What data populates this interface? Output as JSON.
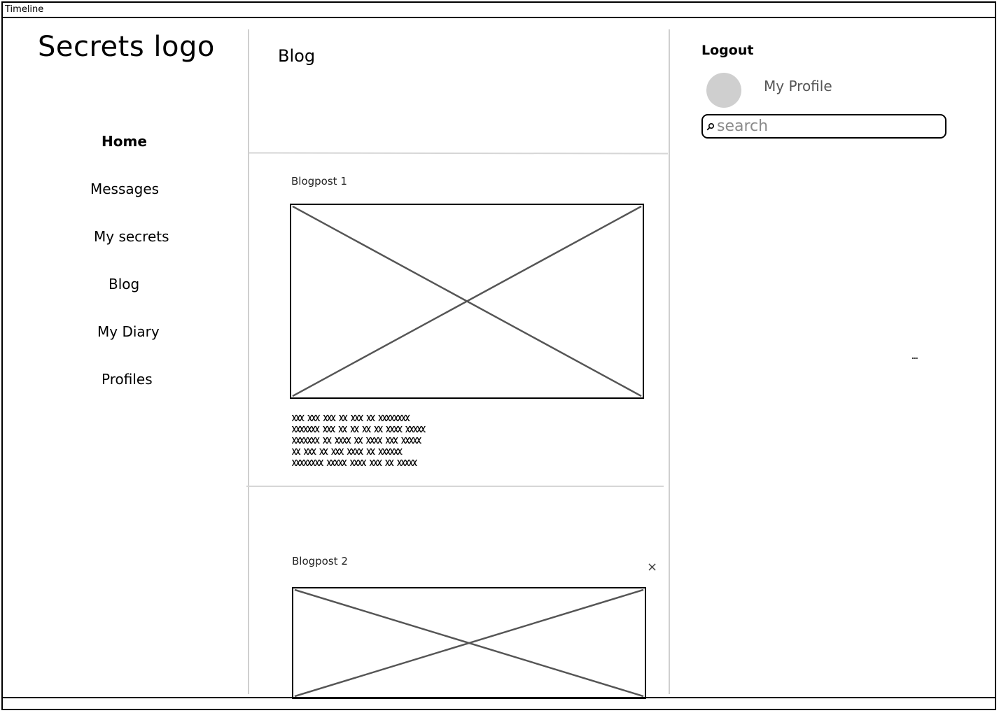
{
  "window": {
    "title": "Timeline"
  },
  "sidebar": {
    "logo": "Secrets logo",
    "items": [
      {
        "label": "Home",
        "active": true
      },
      {
        "label": "Messages",
        "active": false
      },
      {
        "label": "My secrets",
        "active": false
      },
      {
        "label": "Blog",
        "active": false
      },
      {
        "label": "My Diary",
        "active": false
      },
      {
        "label": "Profiles",
        "active": false
      }
    ]
  },
  "main": {
    "title": "Blog",
    "posts": [
      {
        "title": "Blogpost 1",
        "image": "image-placeholder-icon",
        "text_lines": [
          "ꭓꭓꭓ ꭓꭓꭓ ꭓꭓꭓ ꭓꭓ ꭓꭓꭓ ꭓꭓ ꭓꭓꭓꭓꭓꭓꭓꭓ",
          "ꭓꭓꭓꭓꭓꭓꭓ ꭓꭓꭓ ꭓꭓ ꭓꭓ ꭓꭓ ꭓꭓ ꭓꭓꭓꭓ ꭓꭓꭓꭓꭓ",
          "ꭓꭓꭓꭓꭓꭓꭓ ꭓꭓ ꭓꭓꭓꭓ ꭓꭓ ꭓꭓꭓꭓ ꭓꭓꭓ ꭓꭓꭓꭓꭓ",
          "ꭓꭓ ꭓꭓꭓ ꭓꭓ ꭓꭓꭓ ꭓꭓꭓꭓ ꭓꭓ ꭓꭓꭓꭓꭓꭓ",
          "ꭓꭓꭓꭓꭓꭓꭓꭓ ꭓꭓꭓꭓꭓ ꭓꭓꭓꭓ ꭓꭓꭓ ꭓꭓ ꭓꭓꭓꭓꭓ"
        ]
      },
      {
        "title": "Blogpost 2",
        "image": "image-placeholder-icon",
        "close_icon": "close-icon",
        "close_label": "×"
      }
    ]
  },
  "right_panel": {
    "logout_label": "Logout",
    "profile_label": "My Profile",
    "avatar_icon": "avatar",
    "search": {
      "placeholder": "search",
      "value": "",
      "icon": "search-icon"
    },
    "more_label": "..."
  },
  "colors": {
    "border": "#000000",
    "divider": "#d6d6d6",
    "avatar": "#cfcfcf",
    "placeholder_cross": "#555555"
  }
}
